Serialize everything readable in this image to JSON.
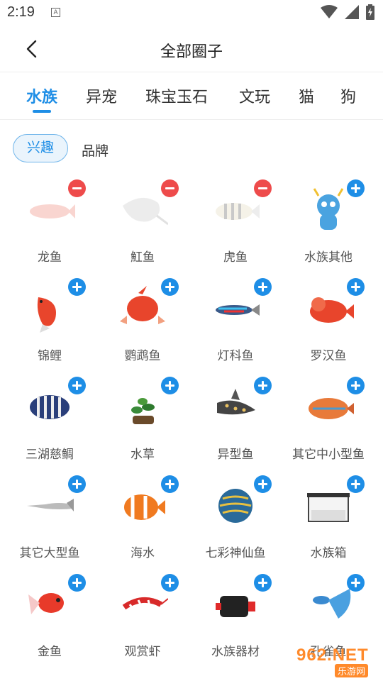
{
  "status_bar": {
    "time": "2:19",
    "notification_letter": "A"
  },
  "header": {
    "title": "全部圈子"
  },
  "tabs": [
    {
      "label": "水族",
      "active": true
    },
    {
      "label": "异宠",
      "active": false
    },
    {
      "label": "珠宝玉石",
      "active": false
    },
    {
      "label": "文玩",
      "active": false
    },
    {
      "label": "猫",
      "active": false
    },
    {
      "label": "狗",
      "active": false
    }
  ],
  "subtabs": {
    "interest": "兴趣",
    "brand": "品牌"
  },
  "items": [
    {
      "label": "龙鱼",
      "state": "joined",
      "icon": "arowana-icon"
    },
    {
      "label": "魟鱼",
      "state": "joined",
      "icon": "stingray-icon"
    },
    {
      "label": "虎鱼",
      "state": "joined",
      "icon": "tiger-fish-icon"
    },
    {
      "label": "水族其他",
      "state": "add",
      "icon": "dragon-mascot-icon"
    },
    {
      "label": "锦鲤",
      "state": "add",
      "icon": "koi-icon"
    },
    {
      "label": "鹦鹉鱼",
      "state": "add",
      "icon": "parrot-fish-icon"
    },
    {
      "label": "灯科鱼",
      "state": "add",
      "icon": "tetra-fish-icon"
    },
    {
      "label": "罗汉鱼",
      "state": "add",
      "icon": "flowerhorn-icon"
    },
    {
      "label": "三湖慈鲷",
      "state": "add",
      "icon": "cichlid-icon"
    },
    {
      "label": "水草",
      "state": "add",
      "icon": "aquatic-plant-icon"
    },
    {
      "label": "异型鱼",
      "state": "add",
      "icon": "pleco-icon"
    },
    {
      "label": "其它中小型鱼",
      "state": "add",
      "icon": "gourami-icon"
    },
    {
      "label": "其它大型鱼",
      "state": "add",
      "icon": "gar-fish-icon"
    },
    {
      "label": "海水",
      "state": "add",
      "icon": "clownfish-icon"
    },
    {
      "label": "七彩神仙鱼",
      "state": "add",
      "icon": "discus-icon"
    },
    {
      "label": "水族箱",
      "state": "add",
      "icon": "aquarium-tank-icon"
    },
    {
      "label": "金鱼",
      "state": "add",
      "icon": "goldfish-icon"
    },
    {
      "label": "观赏虾",
      "state": "add",
      "icon": "shrimp-icon"
    },
    {
      "label": "水族器材",
      "state": "add",
      "icon": "water-pump-icon"
    },
    {
      "label": "孔雀鱼",
      "state": "add",
      "icon": "guppy-icon"
    }
  ],
  "watermark": {
    "brand": "962.NET",
    "site": "乐游网"
  },
  "colors": {
    "accent": "#1e8ee6",
    "remove": "#ee4b4b",
    "watermark": "#ff8a2b"
  }
}
